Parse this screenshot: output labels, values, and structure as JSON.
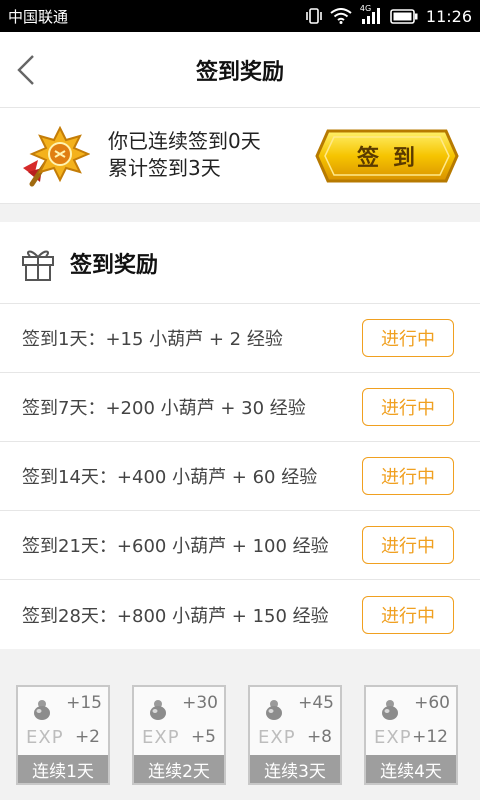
{
  "status_bar": {
    "carrier": "中国联通",
    "network": "4G",
    "time": "11:26"
  },
  "header": {
    "title": "签到奖励"
  },
  "checkin": {
    "streak_text": "你已连续签到0天",
    "total_text": "累计签到3天",
    "sign_button_label": "签到"
  },
  "rewards": {
    "title": "签到奖励",
    "items": [
      {
        "text": "签到1天：+15 小葫芦 + 2 经验",
        "status": "进行中"
      },
      {
        "text": "签到7天：+200 小葫芦 + 30 经验",
        "status": "进行中"
      },
      {
        "text": "签到14天：+400 小葫芦 + 60 经验",
        "status": "进行中"
      },
      {
        "text": "签到21天：+600 小葫芦 + 100 经验",
        "status": "进行中"
      },
      {
        "text": "签到28天：+800 小葫芦 + 150 经验",
        "status": "进行中"
      }
    ]
  },
  "streak_cards": [
    {
      "gourd": "+15",
      "exp_label": "EXP",
      "exp": "+2",
      "label": "连续1天"
    },
    {
      "gourd": "+30",
      "exp_label": "EXP",
      "exp": "+5",
      "label": "连续2天"
    },
    {
      "gourd": "+45",
      "exp_label": "EXP",
      "exp": "+8",
      "label": "连续3天"
    },
    {
      "gourd": "+60",
      "exp_label": "EXP",
      "exp": "+12",
      "label": "连续4天"
    }
  ],
  "colors": {
    "accent": "#f0a020",
    "sign_button_gold": "#f6c400",
    "card_footer": "#9e9e9e"
  },
  "icons": {
    "back": "chevron-left-icon",
    "medal": "medal-icon",
    "gift": "gift-icon",
    "pouch": "gourd-pouch-icon"
  }
}
